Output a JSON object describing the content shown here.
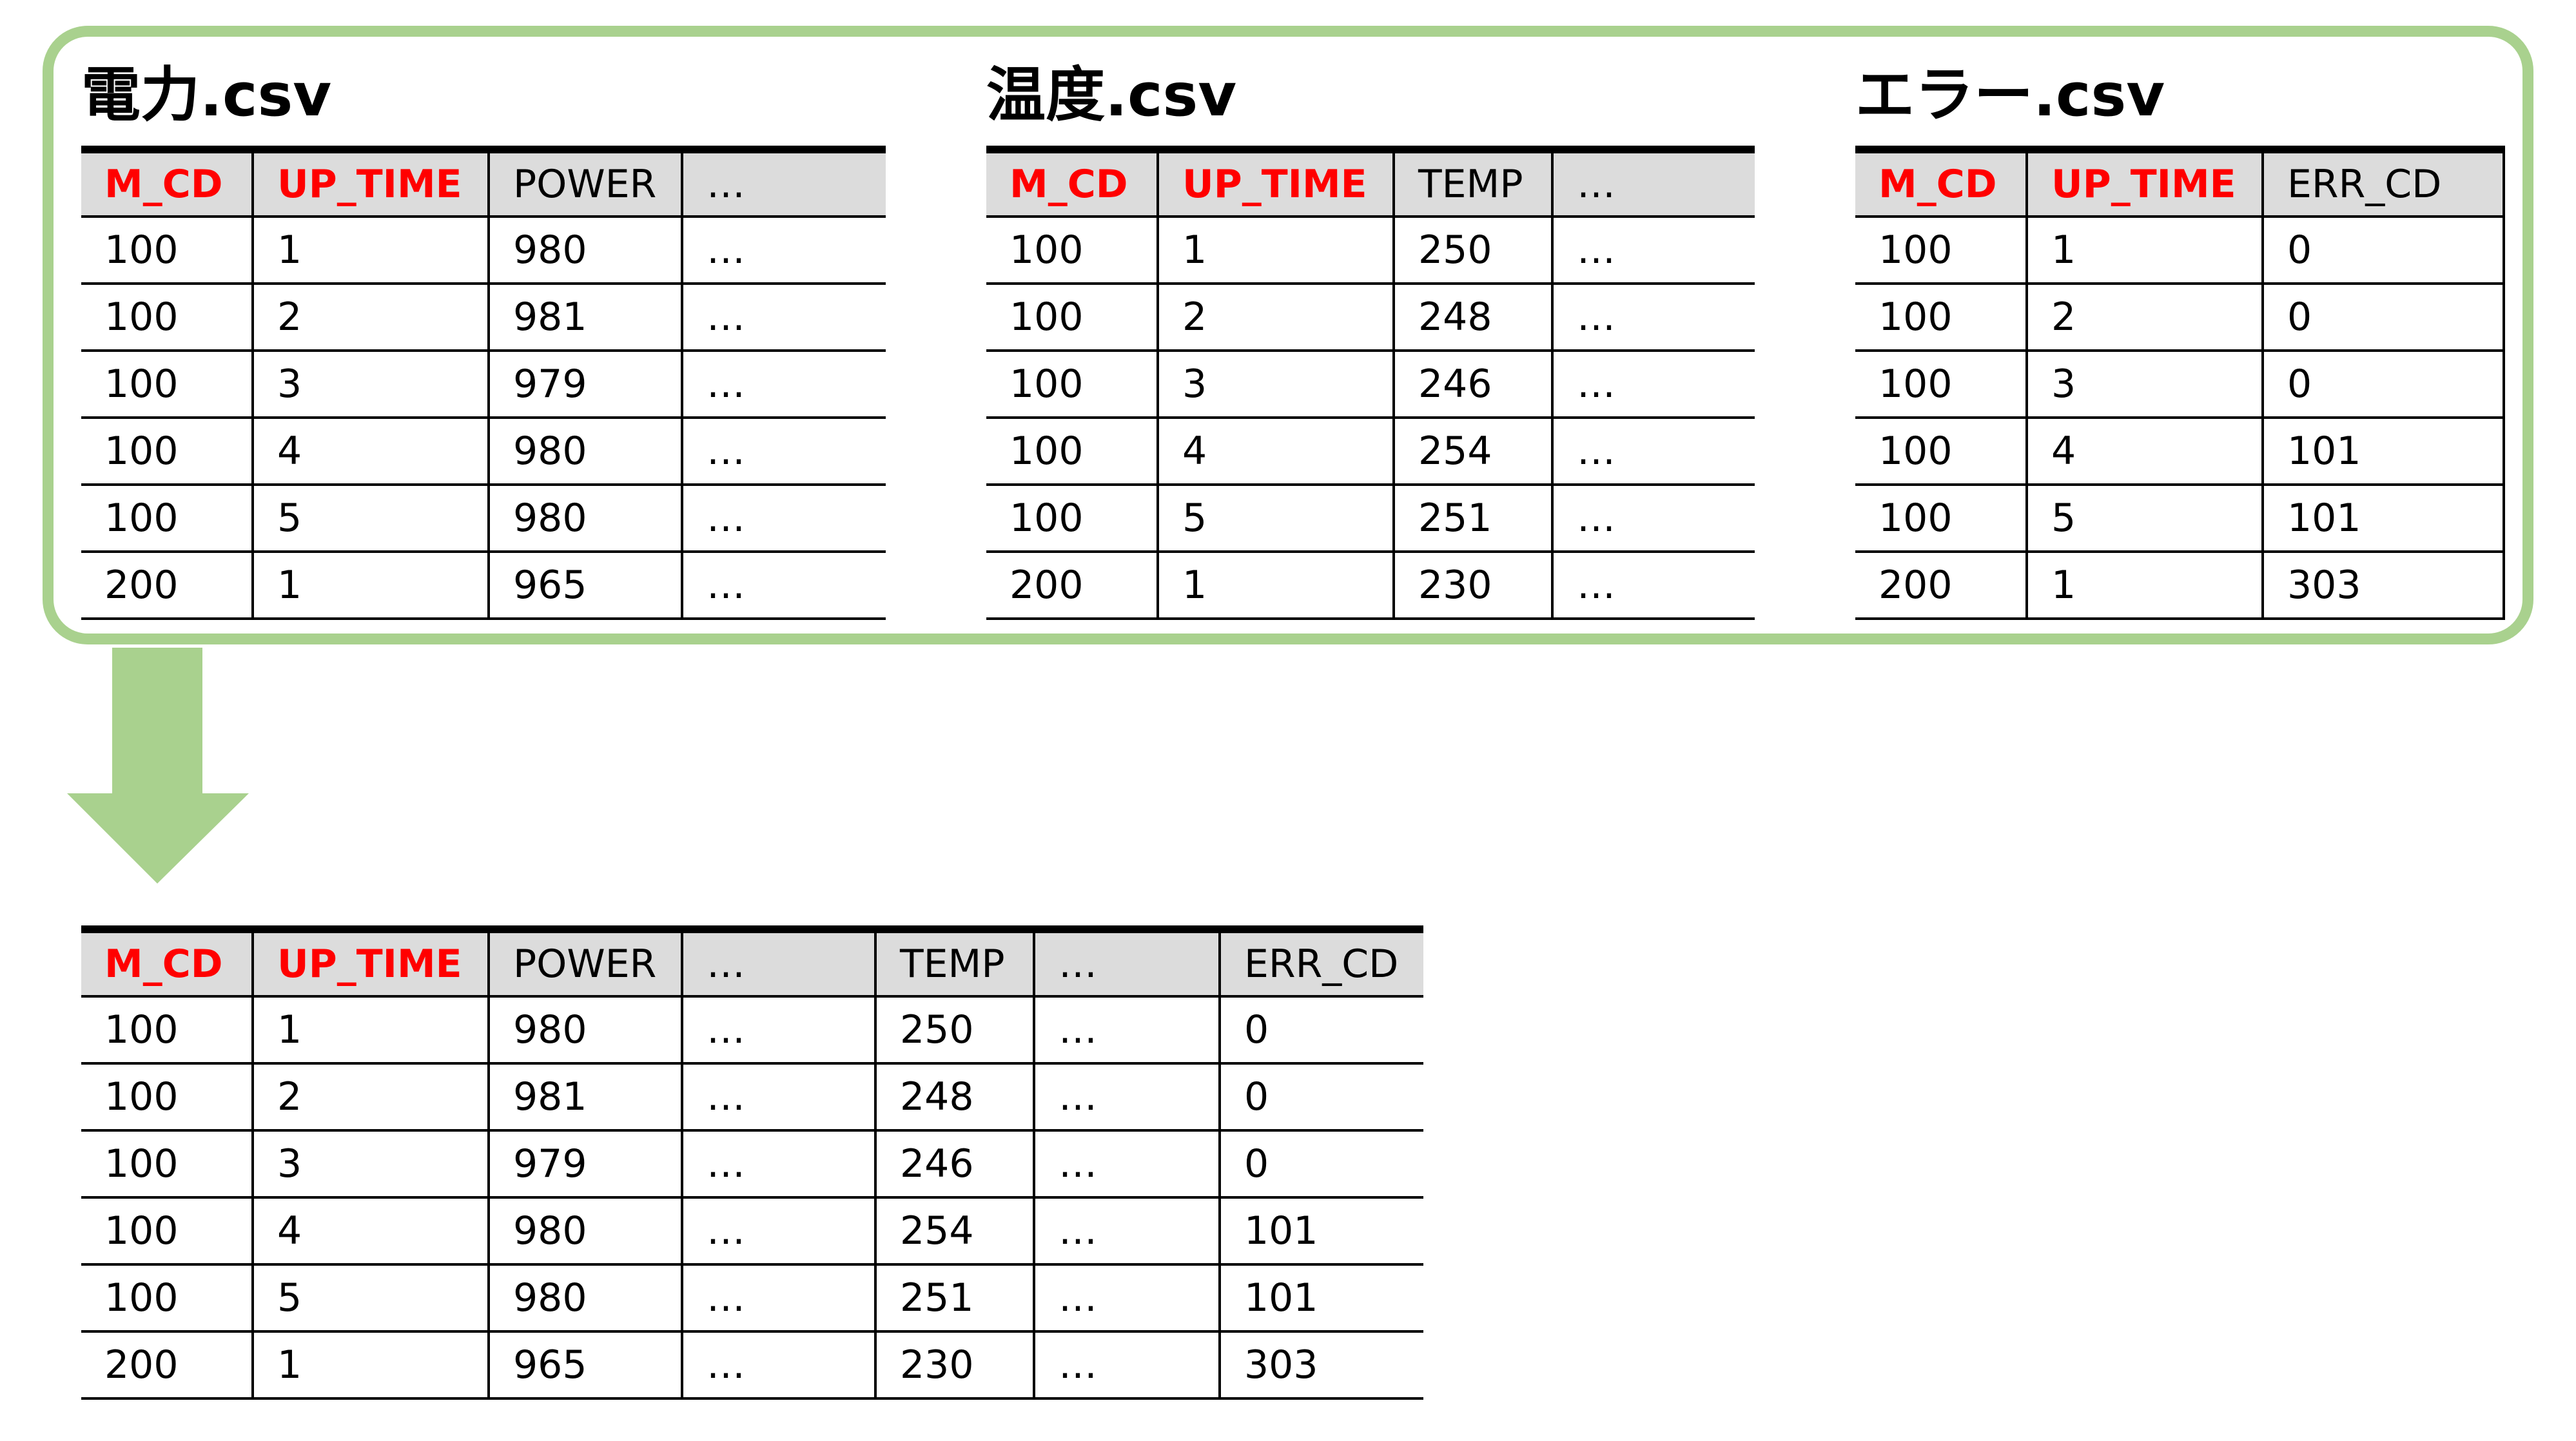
{
  "colors": {
    "frame_border": "#A9D18E",
    "arrow": "#A9D18E",
    "key_header_text": "#FF0000",
    "header_background": "#DCDCDC"
  },
  "sources": [
    {
      "title": "電力.csv",
      "headers": [
        "M_CD",
        "UP_TIME",
        "POWER",
        "…"
      ],
      "key_columns": [
        0,
        1
      ],
      "rows": [
        [
          "100",
          "1",
          "980",
          "…"
        ],
        [
          "100",
          "2",
          "981",
          "…"
        ],
        [
          "100",
          "3",
          "979",
          "…"
        ],
        [
          "100",
          "4",
          "980",
          "…"
        ],
        [
          "100",
          "5",
          "980",
          "…"
        ],
        [
          "200",
          "1",
          "965",
          "…"
        ]
      ]
    },
    {
      "title": "温度.csv",
      "headers": [
        "M_CD",
        "UP_TIME",
        "TEMP",
        "…"
      ],
      "key_columns": [
        0,
        1
      ],
      "rows": [
        [
          "100",
          "1",
          "250",
          "…"
        ],
        [
          "100",
          "2",
          "248",
          "…"
        ],
        [
          "100",
          "3",
          "246",
          "…"
        ],
        [
          "100",
          "4",
          "254",
          "…"
        ],
        [
          "100",
          "5",
          "251",
          "…"
        ],
        [
          "200",
          "1",
          "230",
          "…"
        ]
      ]
    },
    {
      "title": "エラー.csv",
      "headers": [
        "M_CD",
        "UP_TIME",
        "ERR_CD"
      ],
      "key_columns": [
        0,
        1
      ],
      "rows": [
        [
          "100",
          "1",
          "0"
        ],
        [
          "100",
          "2",
          "0"
        ],
        [
          "100",
          "3",
          "0"
        ],
        [
          "100",
          "4",
          "101"
        ],
        [
          "100",
          "5",
          "101"
        ],
        [
          "200",
          "1",
          "303"
        ]
      ]
    }
  ],
  "merged": {
    "headers": [
      "M_CD",
      "UP_TIME",
      "POWER",
      "…",
      "TEMP",
      "…",
      "ERR_CD"
    ],
    "key_columns": [
      0,
      1
    ],
    "rows": [
      [
        "100",
        "1",
        "980",
        "…",
        "250",
        "…",
        "0"
      ],
      [
        "100",
        "2",
        "981",
        "…",
        "248",
        "…",
        "0"
      ],
      [
        "100",
        "3",
        "979",
        "…",
        "246",
        "…",
        "0"
      ],
      [
        "100",
        "4",
        "980",
        "…",
        "254",
        "…",
        "101"
      ],
      [
        "100",
        "5",
        "980",
        "…",
        "251",
        "…",
        "101"
      ],
      [
        "200",
        "1",
        "965",
        "…",
        "230",
        "…",
        "303"
      ]
    ]
  }
}
